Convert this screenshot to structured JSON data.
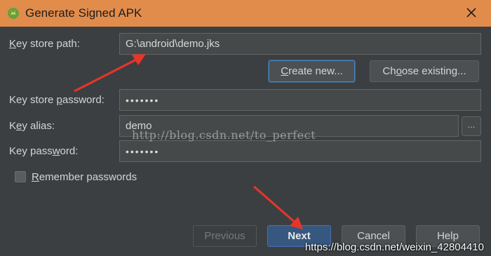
{
  "window": {
    "title": "Generate Signed APK",
    "app_icon": "android-studio-icon",
    "close_icon": "close-icon",
    "titlebar_color": "#e28c4c"
  },
  "form": {
    "key_store_path": {
      "label_pre": "",
      "label_ul": "K",
      "label_post": "ey store path:",
      "value": "G:\\android\\demo.jks"
    },
    "create_new_button": {
      "ul": "C",
      "rest": "reate new..."
    },
    "choose_existing_button": {
      "pre": "Ch",
      "ul": "o",
      "rest": "ose existing..."
    },
    "key_store_password": {
      "label_pre": "Key store ",
      "label_ul": "p",
      "label_post": "assword:",
      "value": "•••••••"
    },
    "key_alias": {
      "label_pre": "K",
      "label_ul": "e",
      "label_post": "y alias:",
      "value": "demo",
      "browse_label": "..."
    },
    "key_password": {
      "label_pre": "Key pass",
      "label_ul": "w",
      "label_post": "ord:",
      "value": "•••••••"
    },
    "remember_passwords": {
      "ul": "R",
      "rest": "emember passwords",
      "checked": false
    }
  },
  "footer": {
    "previous_label": "Previous",
    "next_label": "Next",
    "cancel_label": "Cancel",
    "help_label": "Help"
  },
  "watermarks": {
    "center": "http://blog.csdn.net/to_perfect",
    "corner": "https://blog.csdn.net/weixin_42804410"
  },
  "annotation_color": "#e8352a"
}
